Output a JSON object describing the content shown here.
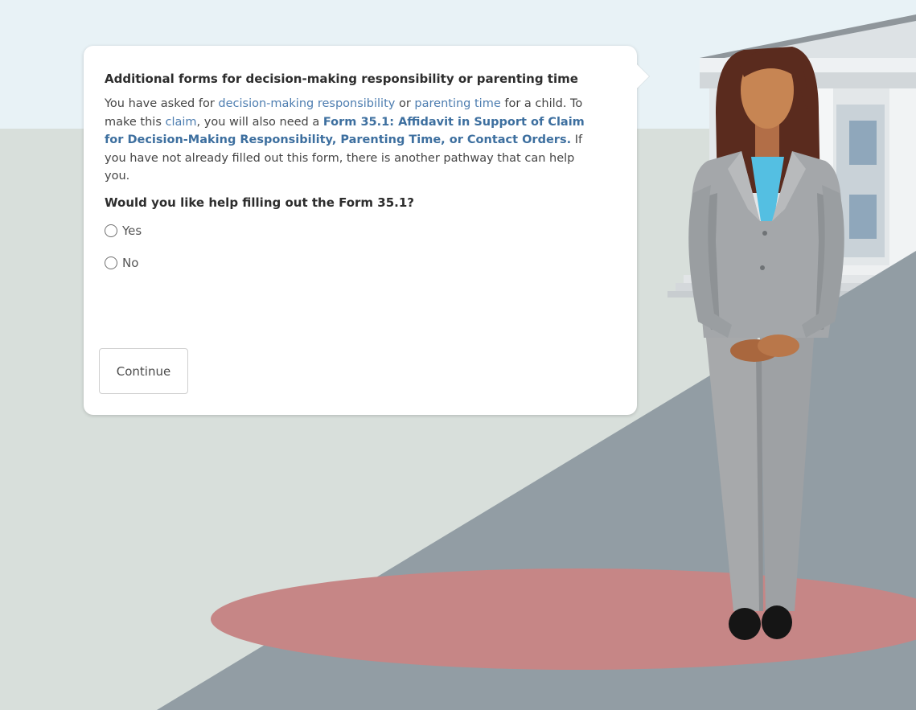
{
  "dialog": {
    "title": "Additional forms for decision-making responsibility or parenting time",
    "body": {
      "part1": "You have asked for ",
      "link_decision": "decision-making responsibility",
      "part2": " or ",
      "link_parenting": "parenting time",
      "part3": " for a child. To make this ",
      "link_claim": "claim",
      "part4": ", you will also need a ",
      "form_link": "Form 35.1: Affidavit in Support of Claim for Decision-Making Responsibility, Parenting Time, or Contact Orders.",
      "part5": " If you have not already filled out this form, there is another pathway that can help you."
    },
    "question": "Would you like help filling out the Form 35.1?",
    "options": [
      {
        "label": "Yes",
        "selected": false
      },
      {
        "label": "No",
        "selected": false
      }
    ],
    "continue_label": "Continue"
  },
  "scene": {
    "icons": [
      "courthouse-icon",
      "guide-character"
    ],
    "colors": {
      "sky": "#e8f2f6",
      "wall": "#d8dfdb",
      "floor": "#929da4",
      "spotlight": "#c68686",
      "link": "#4d7db0"
    }
  }
}
